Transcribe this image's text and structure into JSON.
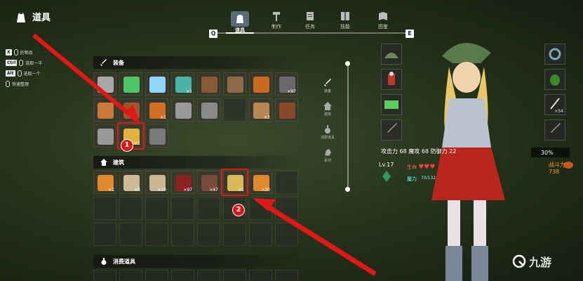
{
  "header": {
    "title": "道具"
  },
  "tabs": [
    {
      "label": "道具",
      "icon": "bag-icon",
      "active": true
    },
    {
      "label": "制作",
      "icon": "hammer-icon",
      "active": false
    },
    {
      "label": "任务",
      "icon": "scroll-icon",
      "active": false
    },
    {
      "label": "技能",
      "icon": "skill-book-icon",
      "active": false
    },
    {
      "label": "图鉴",
      "icon": "book-icon",
      "active": false
    }
  ],
  "tab_keys": {
    "left": "Q",
    "right": "E"
  },
  "hints": [
    {
      "key": "X",
      "label": "扔物品"
    },
    {
      "key": "Ctrl",
      "label": "选取一半"
    },
    {
      "key": "Alt",
      "label": "选取一个"
    },
    {
      "key": "",
      "label": "快速整理"
    }
  ],
  "sections": {
    "equip": {
      "label": "装备"
    },
    "build": {
      "label": "建筑"
    },
    "consume": {
      "label": "消费道具"
    }
  },
  "equip_items": [
    {
      "icon": "spear-icon",
      "count": ""
    },
    {
      "icon": "green-sword-icon",
      "count": ""
    },
    {
      "icon": "crystal-sword-icon",
      "count": ""
    },
    {
      "icon": "gem-helmet-icon",
      "count": "×1"
    },
    {
      "icon": "crossbow-icon",
      "count": ""
    },
    {
      "icon": "bow-icon",
      "count": ""
    },
    {
      "icon": "torch-icon",
      "count": ""
    },
    {
      "icon": "bucket-icon",
      "count": "×97"
    },
    {
      "icon": "shield-icon",
      "count": ""
    },
    {
      "icon": "dagger-icon",
      "count": ""
    },
    {
      "icon": "club-icon",
      "count": "×1"
    },
    {
      "icon": "long-sword-icon",
      "count": ""
    },
    {
      "icon": "spear2-icon",
      "count": ""
    },
    {
      "icon": "empty",
      "count": ""
    },
    {
      "icon": "barrel-icon",
      "count": "×2"
    },
    {
      "icon": "staff-icon",
      "count": ""
    },
    {
      "icon": "axe-icon",
      "count": ""
    },
    {
      "icon": "gold-armor-icon",
      "count": "×1"
    },
    {
      "icon": "war-axe-icon",
      "count": ""
    }
  ],
  "build_items": [
    {
      "icon": "plank-icon",
      "count": "×1"
    },
    {
      "icon": "stone-floor-icon",
      "count": "×8"
    },
    {
      "icon": "wall-icon",
      "count": "×10"
    },
    {
      "icon": "chest-icon",
      "count": "×97"
    },
    {
      "icon": "bed-icon",
      "count": "×47"
    },
    {
      "icon": "lamp-icon",
      "count": "×1"
    },
    {
      "icon": "fence-icon",
      "count": "×30"
    },
    {
      "icon": "empty",
      "count": ""
    }
  ],
  "side_nav": [
    {
      "label": "装备",
      "icon": "sword-icon"
    },
    {
      "label": "建筑",
      "icon": "house-icon"
    },
    {
      "label": "消费道具",
      "icon": "potion-icon"
    },
    {
      "label": "素材",
      "icon": "ore-icon"
    }
  ],
  "stats": {
    "attack_label": "攻击力",
    "attack": "68",
    "magic_label": "魔攻",
    "magic": "68",
    "defense_label": "防御力",
    "defense": "22",
    "level": "Lv.17",
    "life_label": "生命",
    "mana_label": "魔力",
    "mana_value": "70/132"
  },
  "right_panel": {
    "percent": "30%",
    "power_label": "战斗力",
    "power": "738",
    "arrows_count": "×54"
  },
  "annotations": {
    "badge1": "1",
    "badge2": "2"
  },
  "watermark": {
    "text": "九游"
  },
  "colors": {
    "highlight": "#e01818",
    "accent": "#ff9a2a",
    "mana": "#33bbdd"
  }
}
